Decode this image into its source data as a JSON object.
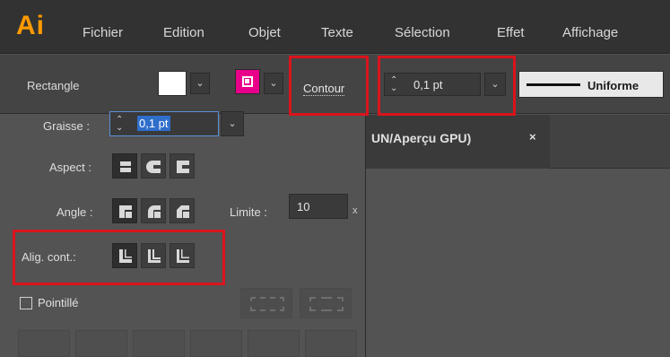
{
  "app": {
    "logo": "Ai"
  },
  "menu": [
    "Fichier",
    "Edition",
    "Objet",
    "Texte",
    "Sélection",
    "Effet",
    "Affichage"
  ],
  "control_bar": {
    "object_type": "Rectangle",
    "fill_color": "#ffffff",
    "stroke_color": "#e8008a",
    "contour_label": "Contour",
    "stroke_weight": "0,1 pt",
    "profile_label": "Uniforme"
  },
  "document_tab": {
    "title": "UN/Aperçu GPU)",
    "close": "×"
  },
  "stroke_panel": {
    "weight_label": "Graisse :",
    "weight_value": "0,1 pt",
    "cap_label": "Aspect :",
    "corner_label": "Angle :",
    "limit_label": "Limite :",
    "limit_value": "10",
    "limit_unit": "x",
    "align_label": "Alig. cont.:",
    "dashed_label": "Pointillé",
    "dashed_checked": false
  },
  "highlight_color": "#d9141c",
  "icons": {
    "spinner": "spinner-icon",
    "dropdown": "chevron-down-icon"
  }
}
